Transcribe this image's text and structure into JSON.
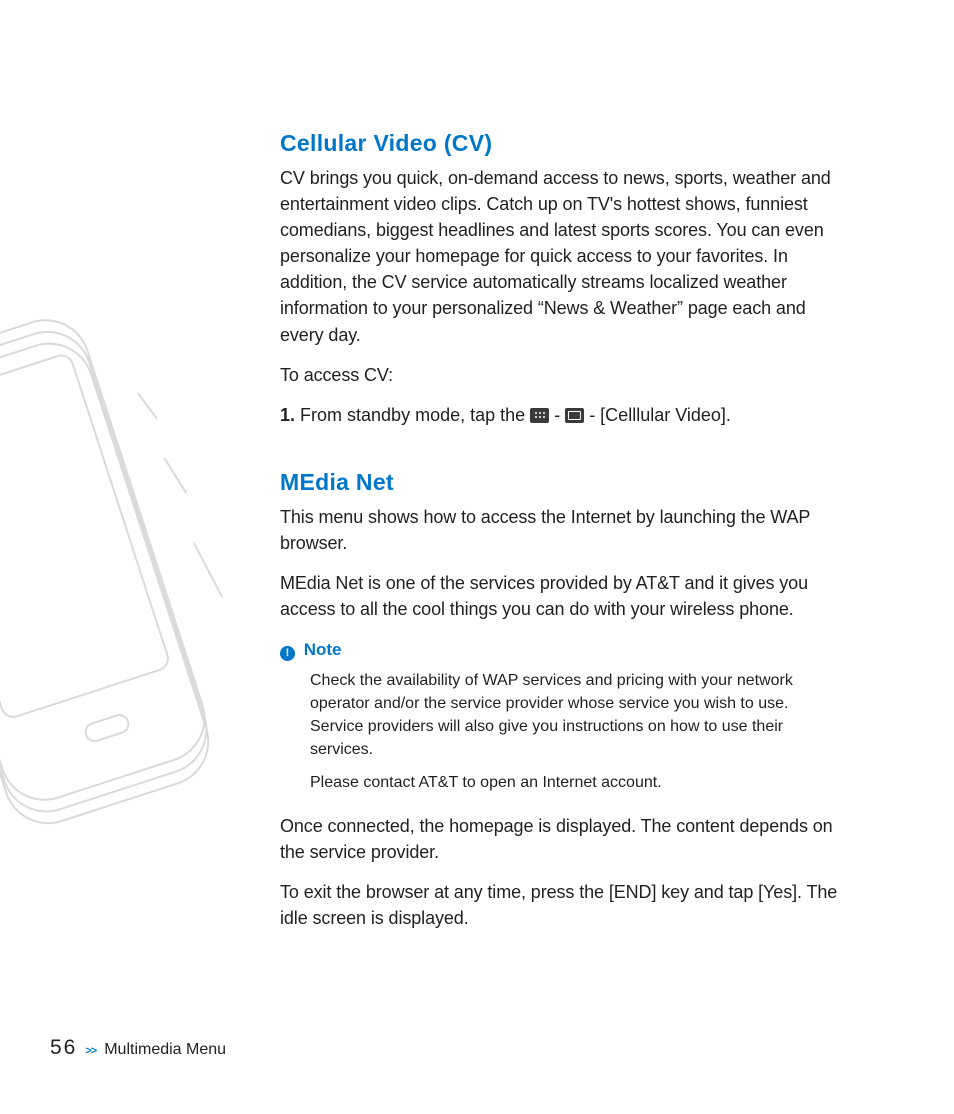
{
  "section1": {
    "title": "Cellular Video (CV)",
    "para1": "CV brings you quick, on-demand access to news, sports, weather and entertainment video clips. Catch up on TV's hottest shows, funniest comedians, biggest headlines and latest sports scores. You can even personalize your homepage for quick access to your favorites. In addition, the CV service automatically streams localized weather information to your personalized “News & Weather” page each and every day.",
    "para2": "To access CV:",
    "step_num": "1.",
    "step_pre": "From standby mode, tap the ",
    "step_sep": " - ",
    "step_post": " - [Celllular Video]."
  },
  "section2": {
    "title": "MEdia Net",
    "para1": "This menu shows how to access the Internet by launching the WAP browser.",
    "para2": "MEdia Net is one of the services provided by AT&T and it gives you access to all the cool things you can do with your wireless phone.",
    "note": {
      "label": "Note",
      "body1": "Check the availability of WAP services and pricing with your network operator and/or the service provider whose service you wish to use. Service providers will also give you instructions on how to use their services.",
      "body2": "Please contact AT&T to open an Internet account."
    },
    "para3": "Once connected, the homepage is displayed. The content depends on the service provider.",
    "para4": "To exit the browser at any time, press the [END] key and tap [Yes]. The idle screen is displayed."
  },
  "footer": {
    "page": "56",
    "chev": ">>",
    "label": "Multimedia Menu"
  }
}
